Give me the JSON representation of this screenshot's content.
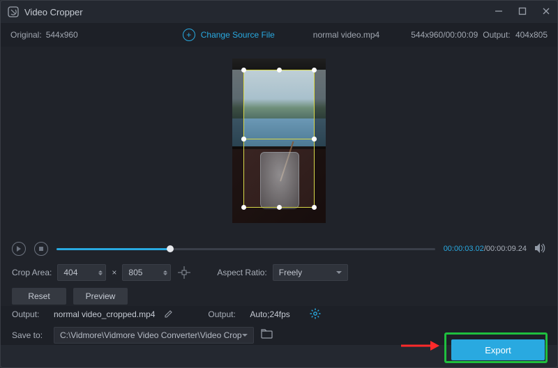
{
  "title": "Video Cropper",
  "infobar": {
    "original_label": "Original:",
    "original_dims": "544x960",
    "change_label": "Change Source File",
    "filename": "normal video.mp4",
    "file_dims_time": "544x960/00:00:09",
    "output_label": "Output:",
    "output_dims": "404x805"
  },
  "playback": {
    "current": "00:00:03.02",
    "sep": "/",
    "total": "00:00:09.24"
  },
  "controls": {
    "crop_area_label": "Crop Area:",
    "width": "404",
    "times": "×",
    "height": "805",
    "aspect_label": "Aspect Ratio:",
    "aspect_value": "Freely",
    "reset": "Reset",
    "preview": "Preview"
  },
  "outputbar": {
    "output_label": "Output:",
    "output_file": "normal video_cropped.mp4",
    "output_fmt_label": "Output:",
    "output_fmt": "Auto;24fps",
    "save_label": "Save to:",
    "save_path": "C:\\Vidmore\\Vidmore Video Converter\\Video Crop"
  },
  "export": "Export"
}
